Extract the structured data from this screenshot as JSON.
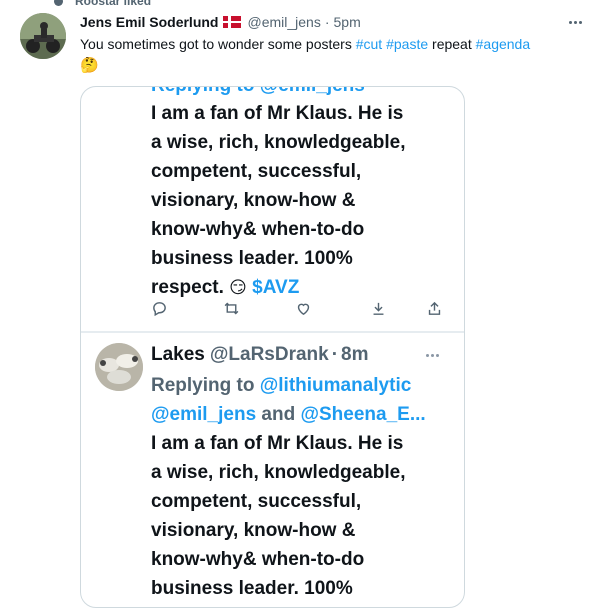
{
  "liked_by": "Roostar liked",
  "tweet": {
    "author_name": "Jens Emil Soderlund",
    "handle": "@emil_jens",
    "separator": "·",
    "time": "5pm",
    "text_plain_1": "You sometimes got to wonder some posters ",
    "hashtag_1": "#cut",
    "space": " ",
    "hashtag_2": "#paste",
    "text_plain_2": " repeat ",
    "hashtag_3": "#agenda",
    "emoji": "🤔"
  },
  "screenshot": {
    "cut_line": "Replying to @emil_jens",
    "lines_top": [
      "I am a fan of Mr Klaus. He is",
      "a wise, rich, knowledgeable,",
      "competent, successful,",
      "visionary, know-how &",
      "know-why& when-to-do",
      "business leader. 100%"
    ],
    "last_line_text": "respect. ",
    "last_line_emoji": "😏",
    "last_line_cashtag": "$AVZ",
    "icons": [
      "reply-icon",
      "retweet-icon",
      "like-icon",
      "download-icon",
      "share-icon"
    ],
    "reply": {
      "name": "Lakes",
      "handle": "@LaRsDrank",
      "separator": "·",
      "time": "8m",
      "replying_prefix": "Replying to ",
      "mention_1": "@lithiumanalytic",
      "mention_2": "@emil_jens",
      "and": " and ",
      "mention_3": "@Sheena_E..."
    },
    "lines_bottom": [
      "I am a fan of Mr Klaus. He is",
      "a wise, rich, knowledgeable,",
      "competent, successful,",
      "visionary, know-how &",
      "know-why& when-to-do",
      "business leader. 100%"
    ]
  },
  "colors": {
    "accent": "#1d9bf0",
    "secondary_text": "#536471",
    "border": "#cfd9de"
  }
}
